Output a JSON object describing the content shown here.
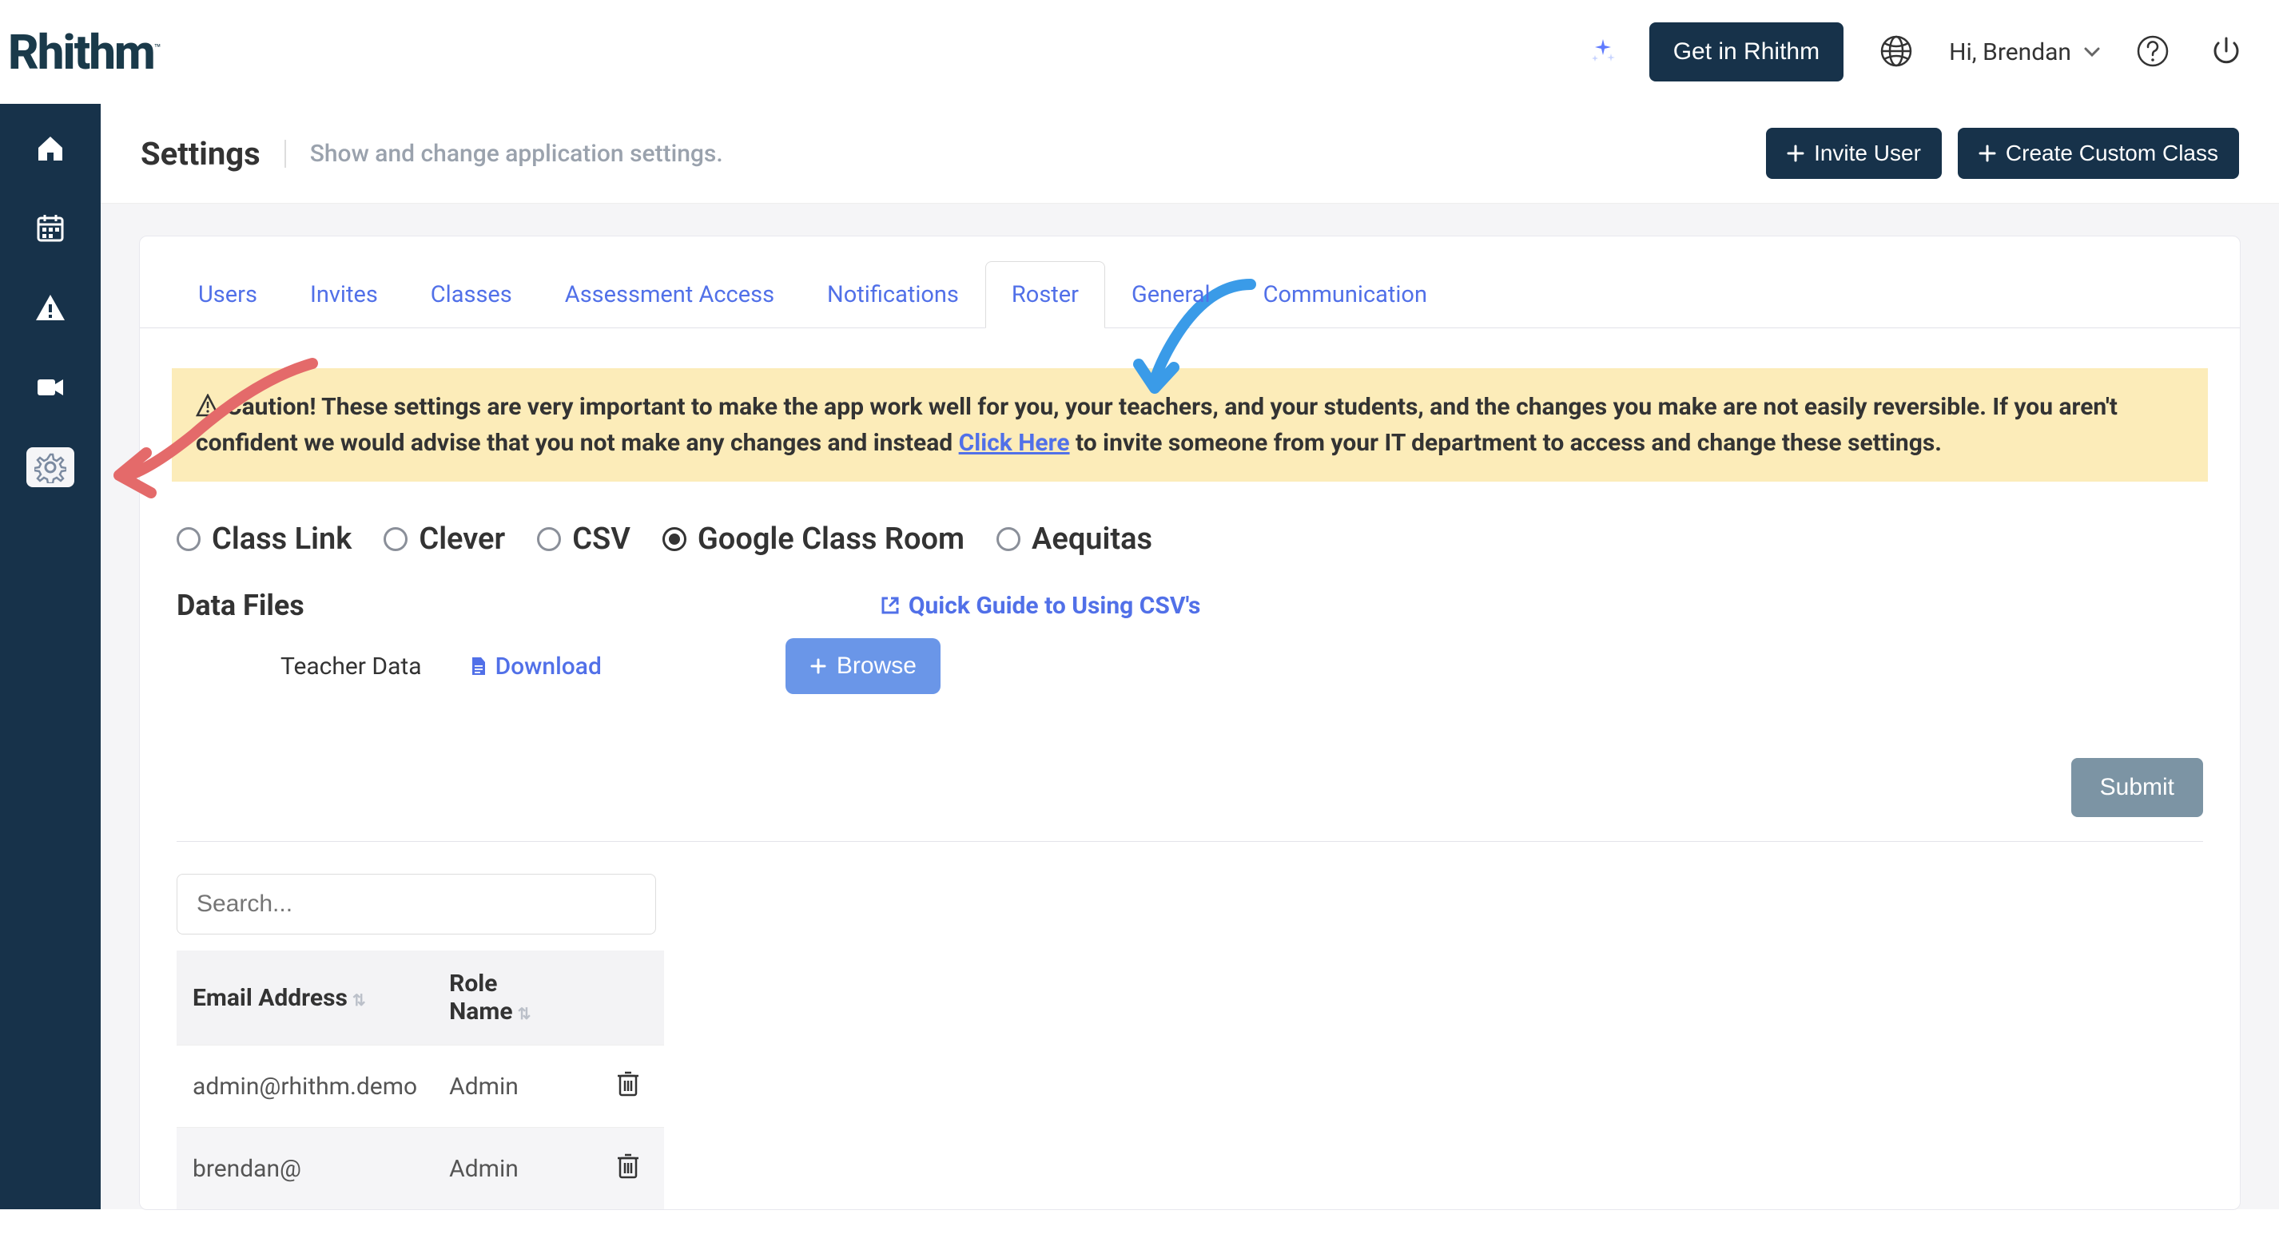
{
  "header": {
    "logo_text": "Rhithm",
    "logo_tm": "™",
    "cta": "Get in Rhithm",
    "greeting": "Hi, Brendan"
  },
  "sidenav": {
    "items": [
      "home",
      "calendar",
      "alerts",
      "video",
      "settings"
    ],
    "active_index": 4
  },
  "page": {
    "title": "Settings",
    "subtitle": "Show and change application settings.",
    "invite_btn": "Invite User",
    "create_class_btn": "Create Custom Class"
  },
  "tabs": {
    "items": [
      "Users",
      "Invites",
      "Classes",
      "Assessment Access",
      "Notifications",
      "Roster",
      "General",
      "Communication"
    ],
    "active_index": 5
  },
  "alert": {
    "prefix": "Caution! These settings are very important to make the app work well for you, your teachers, and your students, and the changes you make are not easily reversible. If you aren't confident we would advise that you not make any changes and instead ",
    "link_text": "Click Here",
    "suffix": " to invite someone from your IT department to access and change these settings."
  },
  "roster": {
    "options": [
      "Class Link",
      "Clever",
      "CSV",
      "Google Class Room",
      "Aequitas"
    ],
    "selected_index": 3,
    "data_files_title": "Data Files",
    "guide_link": "Quick Guide to Using CSV's",
    "teacher_data_label": "Teacher Data",
    "download_label": "Download",
    "browse_label": "Browse",
    "submit_label": "Submit"
  },
  "search": {
    "placeholder": "Search..."
  },
  "table": {
    "cols": [
      "Email Address",
      "Role Name",
      ""
    ],
    "rows": [
      {
        "email": "admin@rhithm.demo",
        "role": "Admin"
      },
      {
        "email": "brendan@",
        "role": "Admin"
      }
    ]
  }
}
